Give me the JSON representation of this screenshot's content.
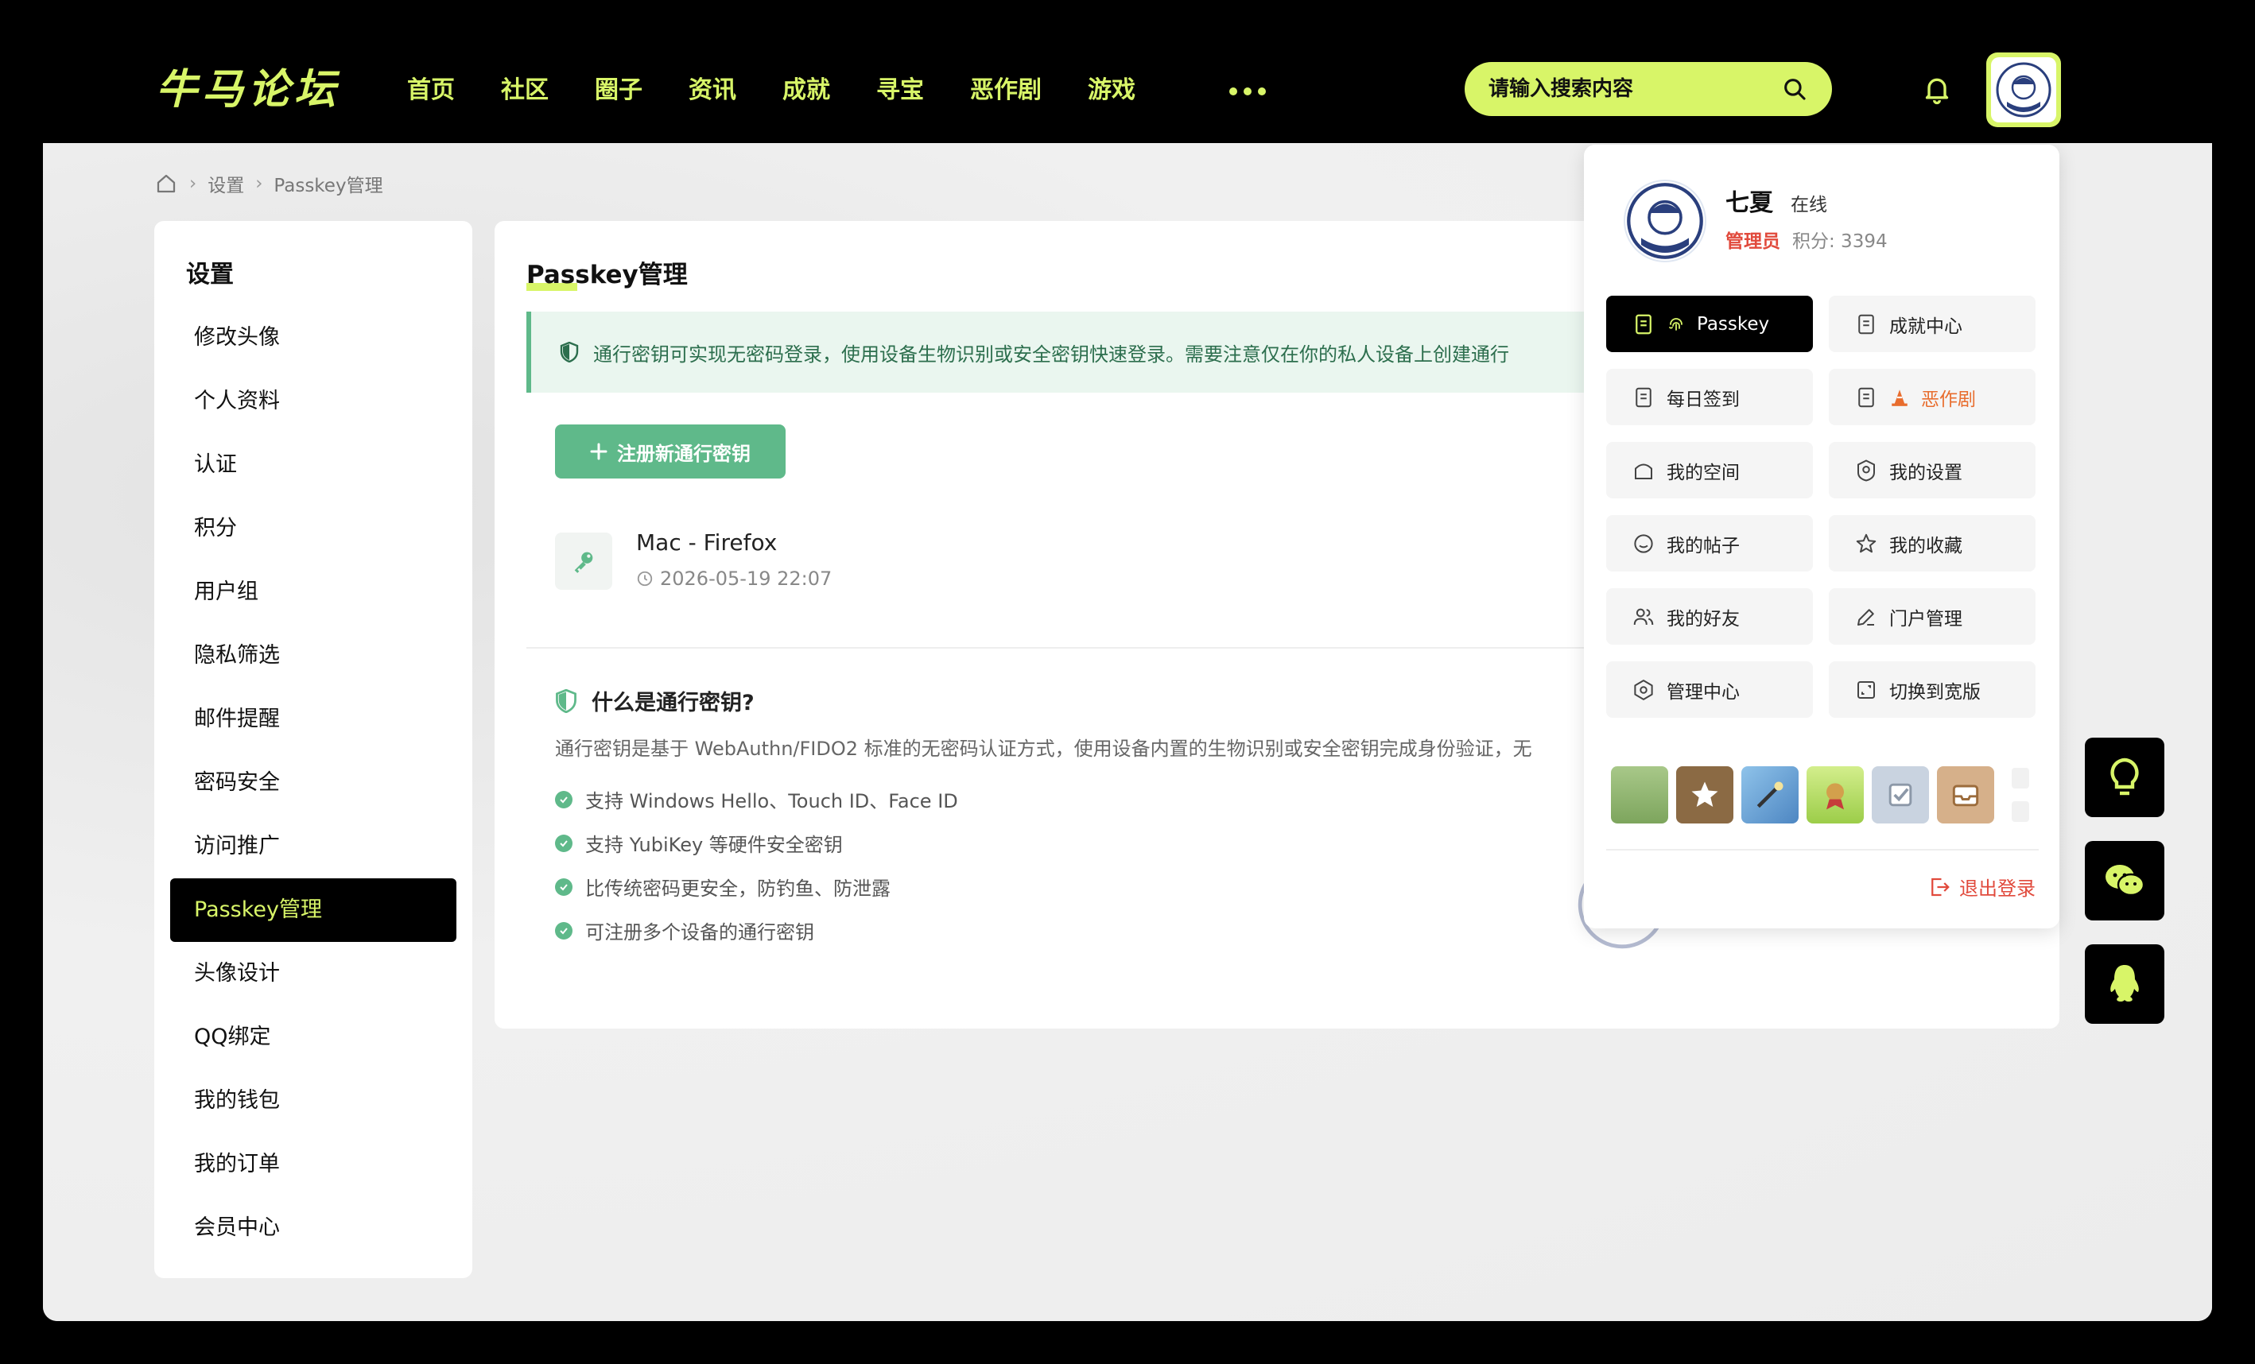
{
  "header": {
    "logo": "牛马论坛",
    "nav": [
      "首页",
      "社区",
      "圈子",
      "资讯",
      "成就",
      "寻宝",
      "恶作剧",
      "游戏"
    ],
    "search_placeholder": "请输入搜索内容"
  },
  "breadcrumb": {
    "items": [
      "设置",
      "Passkey管理"
    ]
  },
  "sidebar": {
    "title": "设置",
    "items": [
      "修改头像",
      "个人资料",
      "认证",
      "积分",
      "用户组",
      "隐私筛选",
      "邮件提醒",
      "密码安全",
      "访问推广",
      "Passkey管理",
      "头像设计",
      "QQ绑定",
      "我的钱包",
      "我的订单",
      "会员中心"
    ],
    "active_index": 9
  },
  "content": {
    "title": "Passkey管理",
    "notice": "通行密钥可实现无密码登录，使用设备生物识别或安全密钥快速登录。需要注意仅在你的私人设备上创建通行",
    "register_button": "注册新通行密钥",
    "passkey": {
      "name": "Mac - Firefox",
      "date": "2026-05-19 22:07"
    },
    "what_title": "什么是通行密钥?",
    "what_desc": "通行密钥是基于 WebAuthn/FIDO2 标准的无密码认证方式，使用设备内置的生物识别或安全密钥完成身份验证，无",
    "features": [
      "支持 Windows Hello、Touch ID、Face ID",
      "支持 YubiKey 等硬件安全密钥",
      "比传统密码更安全，防钓鱼、防泄露",
      "可注册多个设备的通行密钥"
    ]
  },
  "user_menu": {
    "name": "七夏",
    "status": "在线",
    "role": "管理员",
    "points": "积分: 3394",
    "items": [
      "Passkey",
      "成就中心",
      "每日签到",
      "恶作剧",
      "我的空间",
      "我的设置",
      "我的帖子",
      "我的收藏",
      "我的好友",
      "门户管理",
      "管理中心",
      "切换到宽版"
    ],
    "logout": "退出登录"
  },
  "colors": {
    "accent": "#d8f568",
    "green": "#5fb98a",
    "danger": "#e14a3c",
    "warn": "#e86d2e"
  }
}
